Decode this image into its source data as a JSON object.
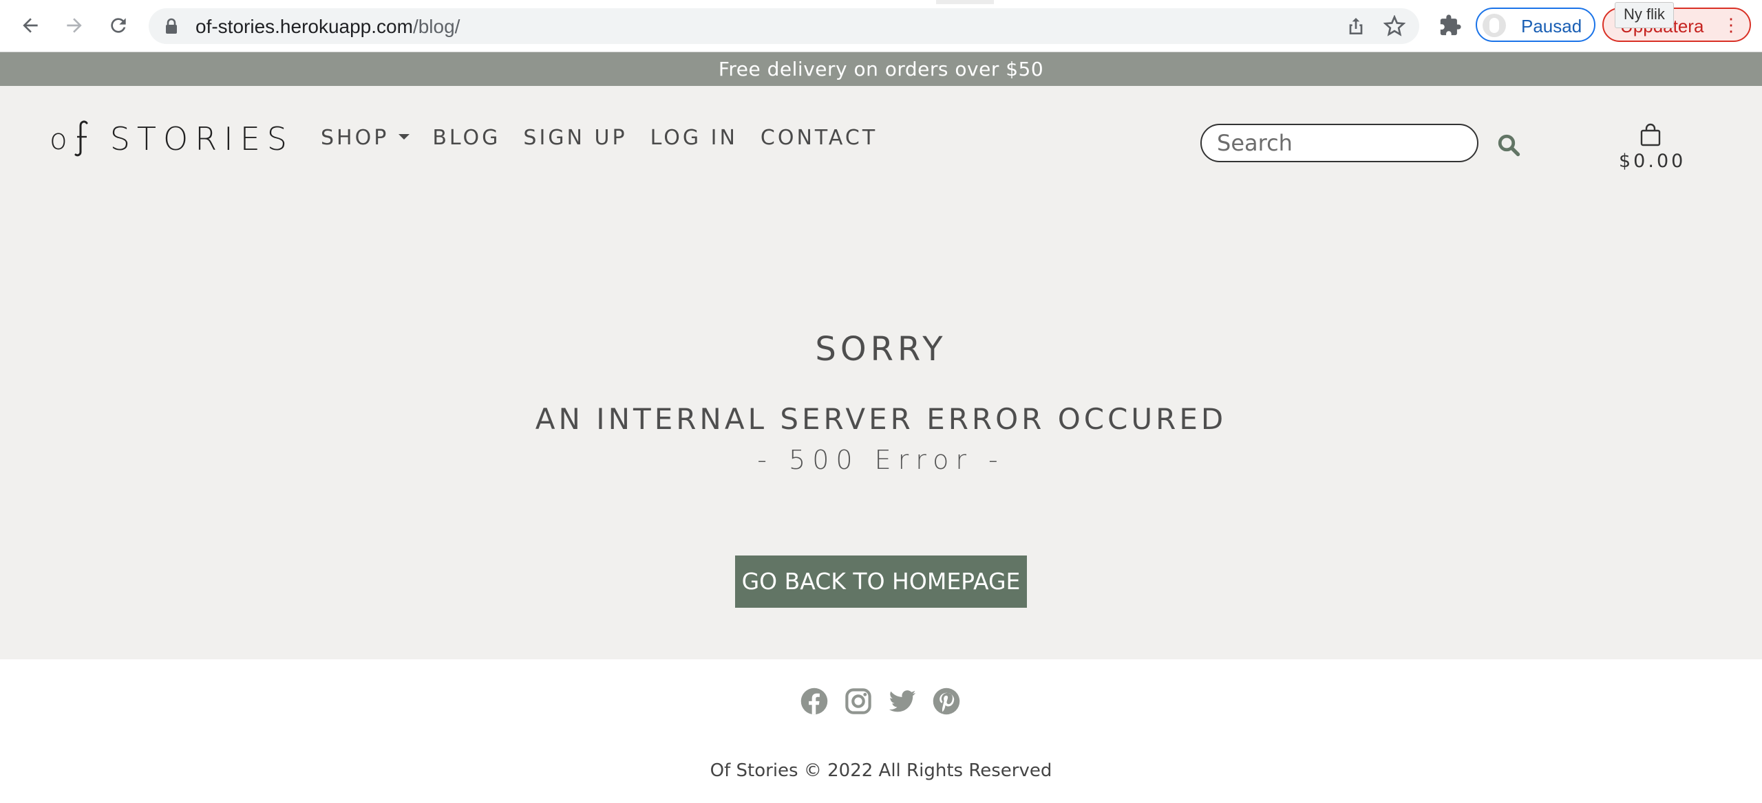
{
  "browser": {
    "url_domain": "of-stories.herokuapp.com",
    "url_path": "/blog/",
    "profile_label": "Pausad",
    "update_label": "Uppdatera",
    "tooltip": "Ny flik",
    "icons": [
      "back-icon",
      "forward-icon",
      "reload-icon",
      "lock-icon",
      "share-icon",
      "star-icon",
      "extensions-icon",
      "kebab-menu-icon"
    ]
  },
  "announcement": {
    "text": "Free delivery on orders over $50",
    "background": "#90958e"
  },
  "header": {
    "logo_o": "o",
    "logo_word": "STORIES",
    "nav": {
      "shop": "SHOP",
      "blog": "BLOG",
      "signup": "SIGN UP",
      "login": "LOG IN",
      "contact": "CONTACT"
    },
    "search_placeholder": "Search",
    "cart_total": "$0.00"
  },
  "error": {
    "title": "SORRY",
    "message": "AN INTERNAL SERVER ERROR OCCURED",
    "code": "- 500 Error -",
    "button": "GO BACK TO HOMEPAGE",
    "button_color": "#627565"
  },
  "footer": {
    "social_icons": [
      "facebook-icon",
      "instagram-icon",
      "twitter-icon",
      "pinterest-icon"
    ],
    "copyright": "Of Stories © 2022 All Rights Reserved"
  },
  "colors": {
    "page_bg": "#f1f0ee",
    "accent": "#627565",
    "text": "#4e4e4e"
  }
}
